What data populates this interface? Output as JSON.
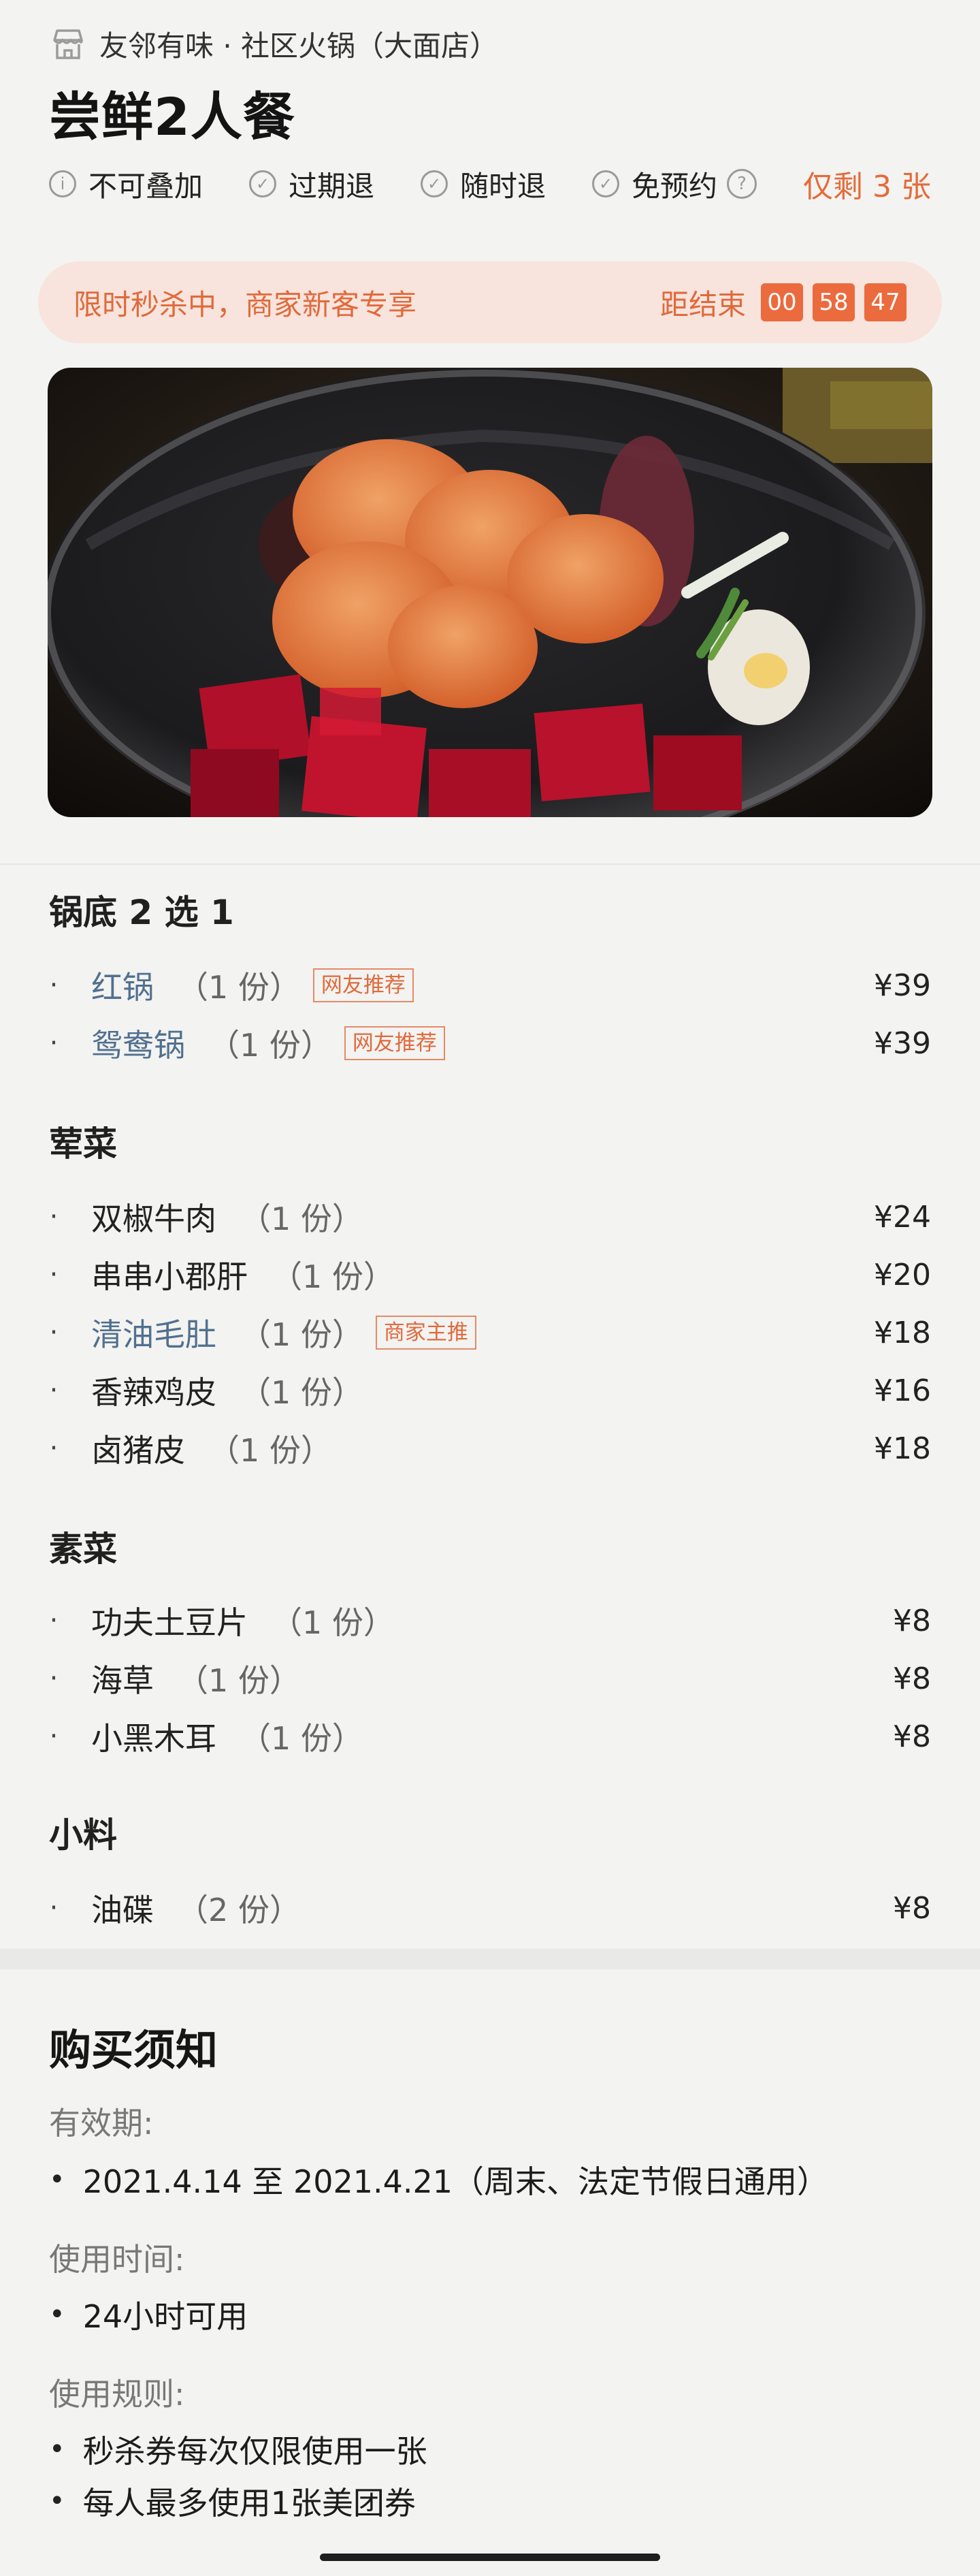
{
  "header": {
    "store_icon": "store-icon",
    "store_name": "友邻有味 · 社区火锅（大面店）",
    "deal_title": "尝鲜2人餐"
  },
  "tags": [
    {
      "icon": "info-icon",
      "label": "不可叠加"
    },
    {
      "icon": "check-circle-icon",
      "label": "过期退"
    },
    {
      "icon": "check-circle-icon",
      "label": "随时退"
    },
    {
      "icon": "check-circle-icon",
      "label": "免预约"
    }
  ],
  "remaining": "仅剩 3 张",
  "flash_sale": {
    "text": "限时秒杀中，商家新客专享",
    "countdown_label": "距结束",
    "hours": "00",
    "minutes": "58",
    "seconds": "47"
  },
  "menu": {
    "sections": [
      {
        "title": "锅底 2 选 1",
        "items": [
          {
            "name": "红锅",
            "qty": "（1 份）",
            "badge": "网友推荐",
            "price": "¥39"
          },
          {
            "name": "鸳鸯锅",
            "qty": "（1 份）",
            "badge": "网友推荐",
            "price": "¥39"
          }
        ]
      },
      {
        "title": "荤菜",
        "items": [
          {
            "name": "双椒牛肉",
            "qty": "（1 份）",
            "price": "¥24"
          },
          {
            "name": "串串小郡肝",
            "qty": "（1 份）",
            "price": "¥20"
          },
          {
            "name": "清油毛肚",
            "qty": "（1 份）",
            "badge": "商家主推",
            "price": "¥18"
          },
          {
            "name": "香辣鸡皮",
            "qty": "（1 份）",
            "price": "¥16"
          },
          {
            "name": "卤猪皮",
            "qty": "（1 份）",
            "price": "¥18"
          }
        ]
      },
      {
        "title": "素菜",
        "items": [
          {
            "name": "功夫土豆片",
            "qty": "（1 份）",
            "price": "¥8"
          },
          {
            "name": "海草",
            "qty": "（1 份）",
            "price": "¥8"
          },
          {
            "name": "小黑木耳",
            "qty": "（1 份）",
            "price": "¥8"
          }
        ]
      },
      {
        "title": "小料",
        "items": [
          {
            "name": "油碟",
            "qty": "（2 份）",
            "price": "¥8"
          }
        ]
      }
    ]
  },
  "notice": {
    "title": "购买须知",
    "validity_label": "有效期:",
    "validity": "2021.4.14 至 2021.4.21（周末、法定节假日通用）",
    "time_label": "使用时间:",
    "time": "24小时可用",
    "rules_label": "使用规则:",
    "rules": [
      "秒杀券每次仅限使用一张",
      "每人最多使用1张美团券"
    ]
  },
  "colors": {
    "accent": "#e56b3a",
    "link_blue": "#51708f",
    "flash_bg": "#f8e4dc"
  }
}
